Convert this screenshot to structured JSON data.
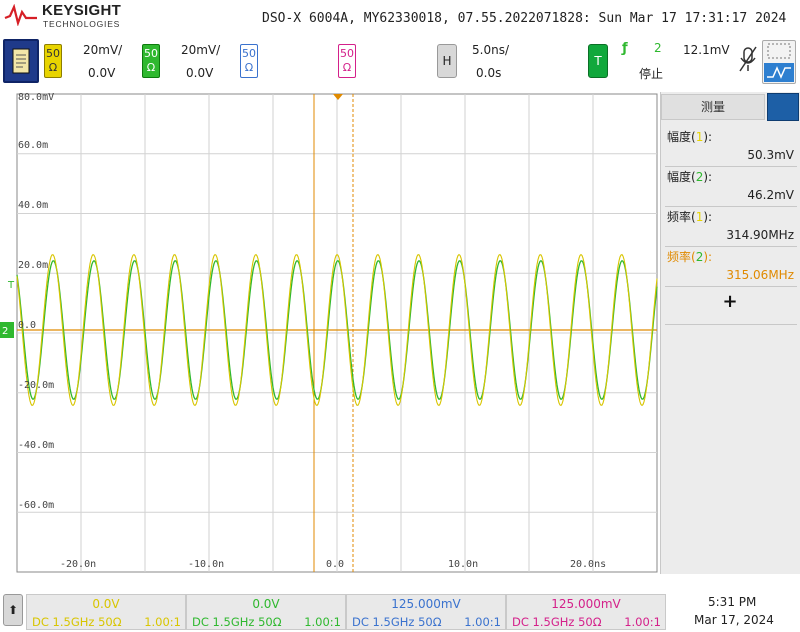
{
  "header": {
    "logo": {
      "name": "KEYSIGHT",
      "sub": "TECHNOLOGIES"
    },
    "title": "DSO-X 6004A, MY62330018, 07.55.2022071828: Sun Mar 17 17:31:17 2024"
  },
  "channels": [
    {
      "id": "1",
      "impedance": "50\nΩ",
      "scale": "20mV/",
      "offset": "0.0V",
      "color": "#e8d400"
    },
    {
      "id": "2",
      "impedance": "50\nΩ",
      "scale": "20mV/",
      "offset": "0.0V",
      "color": "#2fb82f"
    },
    {
      "id": "3",
      "impedance": "50\nΩ",
      "color": "#3a72ce"
    },
    {
      "id": "4",
      "impedance": "50\nΩ",
      "color": "#d4208a"
    }
  ],
  "horizontal": {
    "label": "H",
    "scale": "5.0ns/",
    "delay": "0.0s"
  },
  "trigger": {
    "label": "T",
    "edge": "ƒ",
    "source": "2",
    "level": "12.1mV",
    "state": "停止"
  },
  "grid": {
    "y_labels": [
      "80.0mV",
      "60.0m",
      "40.0m",
      "20.0m",
      "0.0",
      "-20.0m",
      "-40.0m",
      "-60.0m"
    ],
    "x_labels": [
      "-20.0n",
      "-10.0n",
      "0.0",
      "10.0n",
      "20.0ns"
    ],
    "ch_marker": "2",
    "trig_marker": "T"
  },
  "measure": {
    "tab": "测量",
    "items": [
      {
        "label": "幅度(",
        "ch": "1",
        "end": "):",
        "value": "50.3mV",
        "color": "#222"
      },
      {
        "label": "幅度(",
        "ch": "2",
        "end": "):",
        "value": "46.2mV",
        "color": "#222"
      },
      {
        "label": "频率(",
        "ch": "1",
        "end": "):",
        "value": "314.90MHz",
        "color": "#222"
      },
      {
        "label": "频率(",
        "ch": "2",
        "end": "):",
        "value": "315.06MHz",
        "color": "#e08a00"
      }
    ],
    "add": "+"
  },
  "status": {
    "up": "⬆",
    "channels": [
      {
        "offset": "0.0V",
        "coupling": "DC 1.5GHz 50Ω",
        "probe": "1.00:1",
        "color": "#e8d400"
      },
      {
        "offset": "0.0V",
        "coupling": "DC 1.5GHz 50Ω",
        "probe": "1.00:1",
        "color": "#2fb82f"
      },
      {
        "offset": "125.000mV",
        "coupling": "DC 1.5GHz 50Ω",
        "probe": "1.00:1",
        "color": "#3a72ce"
      },
      {
        "offset": "125.000mV",
        "coupling": "DC 1.5GHz 50Ω",
        "probe": "1.00:1",
        "color": "#d4208a"
      }
    ],
    "time": "5:31 PM",
    "date": "Mar 17, 2024"
  }
}
